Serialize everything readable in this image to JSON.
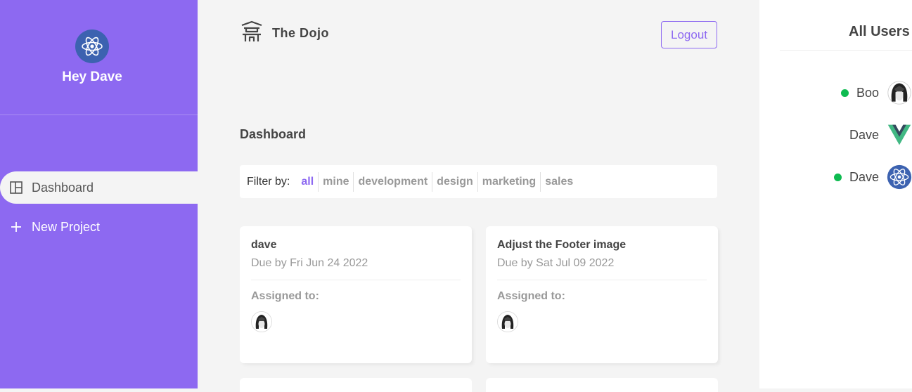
{
  "sidebar": {
    "user_avatar_icon": "react-logo-icon",
    "greeting": "Hey Dave",
    "nav": {
      "dashboard_label": "Dashboard",
      "dashboard_icon": "dashboard-layout-icon",
      "new_project_label": "New Project",
      "new_project_icon": "plus-icon"
    }
  },
  "header": {
    "logo_icon": "temple-icon",
    "brand_title": "The Dojo",
    "logout_label": "Logout"
  },
  "main": {
    "page_title": "Dashboard",
    "filter": {
      "label": "Filter by:",
      "options": [
        "all",
        "mine",
        "development",
        "design",
        "marketing",
        "sales"
      ],
      "active": "all"
    },
    "projects": [
      {
        "title": "dave",
        "due": "Due by Fri Jun 24 2022",
        "assigned_label": "Assigned to:",
        "assignee_icon": "anime-avatar-icon"
      },
      {
        "title": "Adjust the Footer image",
        "due": "Due by Sat Jul 09 2022",
        "assigned_label": "Assigned to:",
        "assignee_icon": "anime-avatar-icon"
      }
    ]
  },
  "users_panel": {
    "title": "All Users",
    "users": [
      {
        "name": "Boo",
        "online": true,
        "avatar_icon": "anime-avatar-icon"
      },
      {
        "name": "Dave",
        "online": false,
        "avatar_icon": "vue-logo-icon"
      },
      {
        "name": "Dave",
        "online": true,
        "avatar_icon": "react-logo-icon"
      }
    ]
  },
  "colors": {
    "primary": "#8d69f1",
    "background": "#f4f4f4",
    "heading": "#444444",
    "muted": "#999999",
    "online": "#0ebb50",
    "react_blue": "#3c62b0",
    "vue_green": "#41b883",
    "vue_dark": "#35495e"
  }
}
